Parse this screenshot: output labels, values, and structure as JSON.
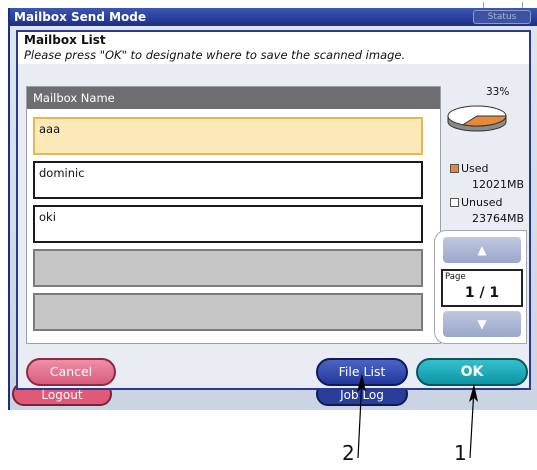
{
  "window": {
    "title": "Mailbox Send Mode",
    "status_label": "Status"
  },
  "background_buttons": {
    "logout": "Logout",
    "job_log": "Job Log"
  },
  "dialog": {
    "title": "Mailbox List",
    "instruction": "Please press \"OK\" to designate where to save the scanned image.",
    "list_header": "Mailbox Name",
    "mailboxes": [
      {
        "name": "aaa",
        "selected": true
      },
      {
        "name": "dominic",
        "selected": false
      },
      {
        "name": "oki",
        "selected": false
      },
      {
        "name": "",
        "empty": true
      },
      {
        "name": "",
        "empty": true
      }
    ],
    "usage": {
      "percent_label": "33%",
      "used_fraction": 0.33,
      "used_label": "Used",
      "used_value": "12021MB",
      "unused_label": "Unused",
      "unused_value": "23764MB",
      "used_color": "#e5893a",
      "unused_color": "#ffffff"
    },
    "pager": {
      "label": "Page",
      "value": "1 / 1",
      "up_icon": "▲",
      "down_icon": "▼"
    },
    "buttons": {
      "cancel": "Cancel",
      "file_list": "File List",
      "ok": "OK"
    }
  },
  "callouts": [
    {
      "number": "2"
    },
    {
      "number": "1"
    }
  ]
}
